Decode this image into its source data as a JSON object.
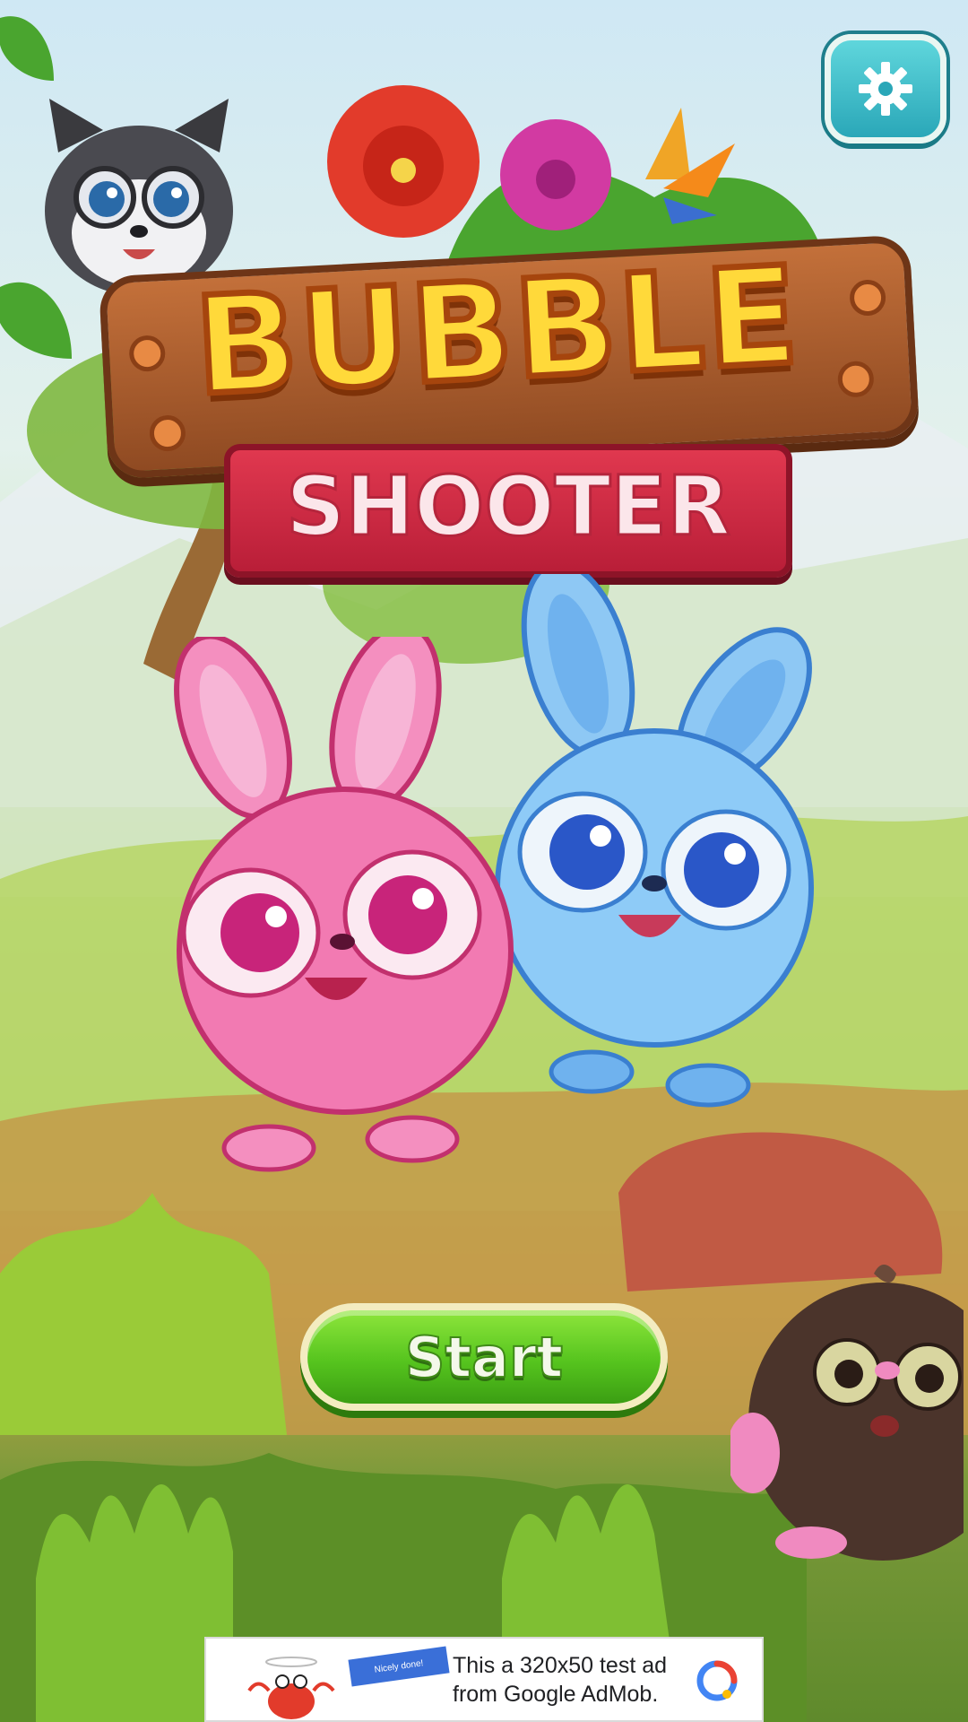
{
  "title": {
    "main": "BUBBLE",
    "sub": "SHOOTER"
  },
  "settings": {
    "icon": "gear-icon"
  },
  "start_button": {
    "label": "Start"
  },
  "ad": {
    "line1": "This a 320x50 test ad",
    "line2": "from Google AdMob.",
    "badge": "Nicely done!",
    "logo_icon": "admob-logo-icon"
  },
  "characters": [
    "raccoon",
    "pink-bunny",
    "blue-bunny",
    "mole"
  ],
  "colors": {
    "title_yellow": "#ffd93a",
    "sign_red": "#d12c45",
    "start_green": "#56c41e",
    "settings_teal": "#2aa7b8"
  }
}
